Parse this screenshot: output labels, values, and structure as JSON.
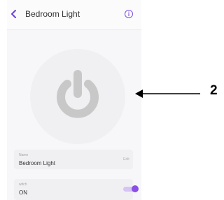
{
  "header": {
    "title": "Bedroom Light",
    "back_icon": "chevron-left-icon",
    "info_icon": "info-icon"
  },
  "power": {
    "icon": "power-icon",
    "state_color": "#c8c8c8"
  },
  "name_card": {
    "label": "Name",
    "value": "Bedroom Light",
    "edit_label": "Edit"
  },
  "switch_card": {
    "label": "witch",
    "value": "ON",
    "toggle_on": true
  },
  "annotation": {
    "number": "2"
  },
  "colors": {
    "accent": "#8a4fe6",
    "toggle_track": "#d6c4f5",
    "background": "#f7f7f9"
  }
}
